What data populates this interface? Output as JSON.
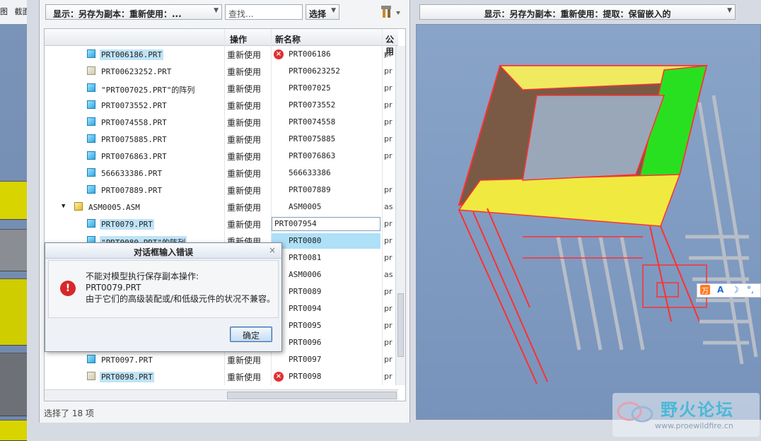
{
  "left_strip": {
    "tab1": "图",
    "tab2": "截面"
  },
  "toolbar": {
    "display_combo": "显示：另存为副本：重新使用：...",
    "search_placeholder": "查找...",
    "select_button": "选择"
  },
  "tree": {
    "columns": {
      "operation": "操作",
      "new_name": "新名称",
      "public": "公用"
    },
    "rows": [
      {
        "name": "PRT006186.PRT",
        "icon": "cube",
        "op": "重新使用",
        "new_name": "PRT006186",
        "pub": "pr",
        "selected": true,
        "error": true
      },
      {
        "name": "PRT00623252.PRT",
        "icon": "doc",
        "op": "重新使用",
        "new_name": "PRT00623252",
        "pub": "pr"
      },
      {
        "name": "\"PRT007025.PRT\"的阵列",
        "icon": "cube",
        "op": "重新使用",
        "new_name": "PRT007025",
        "pub": "pr"
      },
      {
        "name": "PRT0073552.PRT",
        "icon": "cube",
        "op": "重新使用",
        "new_name": "PRT0073552",
        "pub": "pr"
      },
      {
        "name": "PRT0074558.PRT",
        "icon": "cube",
        "op": "重新使用",
        "new_name": "PRT0074558",
        "pub": "pr"
      },
      {
        "name": "PRT0075885.PRT",
        "icon": "cube",
        "op": "重新使用",
        "new_name": "PRT0075885",
        "pub": "pr"
      },
      {
        "name": "PRT0076863.PRT",
        "icon": "cube",
        "op": "重新使用",
        "new_name": "PRT0076863",
        "pub": "pr"
      },
      {
        "name": "566633386.PRT",
        "icon": "cube",
        "op": "重新使用",
        "new_name": "566633386",
        "pub": ""
      },
      {
        "name": "PRT007889.PRT",
        "icon": "cube",
        "op": "重新使用",
        "new_name": "PRT007889",
        "pub": "pr"
      },
      {
        "name": "ASM0005.ASM",
        "icon": "asm",
        "op": "重新使用",
        "new_name": "ASM0005",
        "pub": "as",
        "expander": "▼"
      },
      {
        "name": "PRT0079.PRT",
        "icon": "cube",
        "op": "重新使用",
        "new_name": "PRT007954",
        "pub": "pr",
        "selected": true,
        "editing": true
      },
      {
        "name": "\"PRT0080.PRT\"的阵列",
        "icon": "cube",
        "op": "重新使用",
        "new_name": "PRT0080",
        "pub": "pr",
        "selected": true,
        "error": true,
        "nn_selected": true
      },
      {
        "name": "",
        "icon": "",
        "op": "",
        "new_name": "PRT0081",
        "pub": "pr"
      },
      {
        "name": "",
        "icon": "",
        "op": "",
        "new_name": "ASM0006",
        "pub": "as"
      },
      {
        "name": "",
        "icon": "",
        "op": "",
        "new_name": "PRT0089",
        "pub": "pr"
      },
      {
        "name": "",
        "icon": "",
        "op": "",
        "new_name": "PRT0094",
        "pub": "pr"
      },
      {
        "name": "",
        "icon": "",
        "op": "",
        "new_name": "PRT0095",
        "pub": "pr"
      },
      {
        "name": "",
        "icon": "",
        "op": "",
        "new_name": "PRT0096",
        "pub": "pr"
      },
      {
        "name": "PRT0097.PRT",
        "icon": "cube",
        "op": "重新使用",
        "new_name": "PRT0097",
        "pub": "pr"
      },
      {
        "name": "PRT0098.PRT",
        "icon": "doc",
        "op": "重新使用",
        "new_name": "PRT0098",
        "pub": "pr",
        "selected": true,
        "error": true
      }
    ]
  },
  "status": "选择了 18 项",
  "right_combo": "显示：另存为副本：重新使用：提取：保留嵌入的",
  "dialog": {
    "title": "对话框输入错误",
    "close": "×",
    "line1": "不能对模型执行保存副本操作:",
    "line2": "PRT0079.PRT",
    "line3": "由于它们的高级装配或/和低级元件的状况不兼容。",
    "ok": "确定"
  },
  "ime": {
    "a": "A"
  },
  "watermark": {
    "title": "野火论坛",
    "url": "www.proewildfire.cn"
  }
}
